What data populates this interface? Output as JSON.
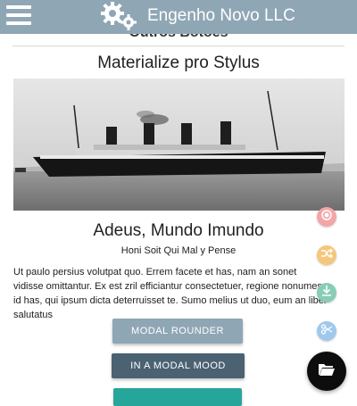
{
  "header": {
    "brand": "Engenho Novo LLC",
    "menu_icon": "hamburger-menu-icon",
    "logo_icon": "gears-icon",
    "background": "#8fa6b5"
  },
  "page": {
    "partial_title": "Outros Botões"
  },
  "card": {
    "title": "Materialize pro Stylus",
    "image_subject": "ship-photo"
  },
  "article": {
    "headline": "Adeus, Mundo Imundo",
    "subheadline": "Honi Soit Qui Mal y Pense",
    "body": "Ut paulo persius volutpat quo. Errem facete et has, nam an sonet vidisse omittantur. Ex est zril efficiantur consectetuer, regione nonumes id has, qui ipsum dicta deterruisset te. Sumo melius ut duo, eum an liber salutatus"
  },
  "buttons": {
    "modal_rounder": "MODAL ROUNDER",
    "in_a_modal_mood": "IN A MODAL MOOD",
    "third": ""
  },
  "fab": {
    "main_icon": "folder-open-icon",
    "actions": [
      {
        "icon": "record-icon",
        "color": "#f4a6a6"
      },
      {
        "icon": "shuffle-icon",
        "color": "#f5c77a"
      },
      {
        "icon": "download-icon",
        "color": "#88cdb6"
      },
      {
        "icon": "scissors-icon",
        "color": "#9fc9ec"
      }
    ]
  }
}
